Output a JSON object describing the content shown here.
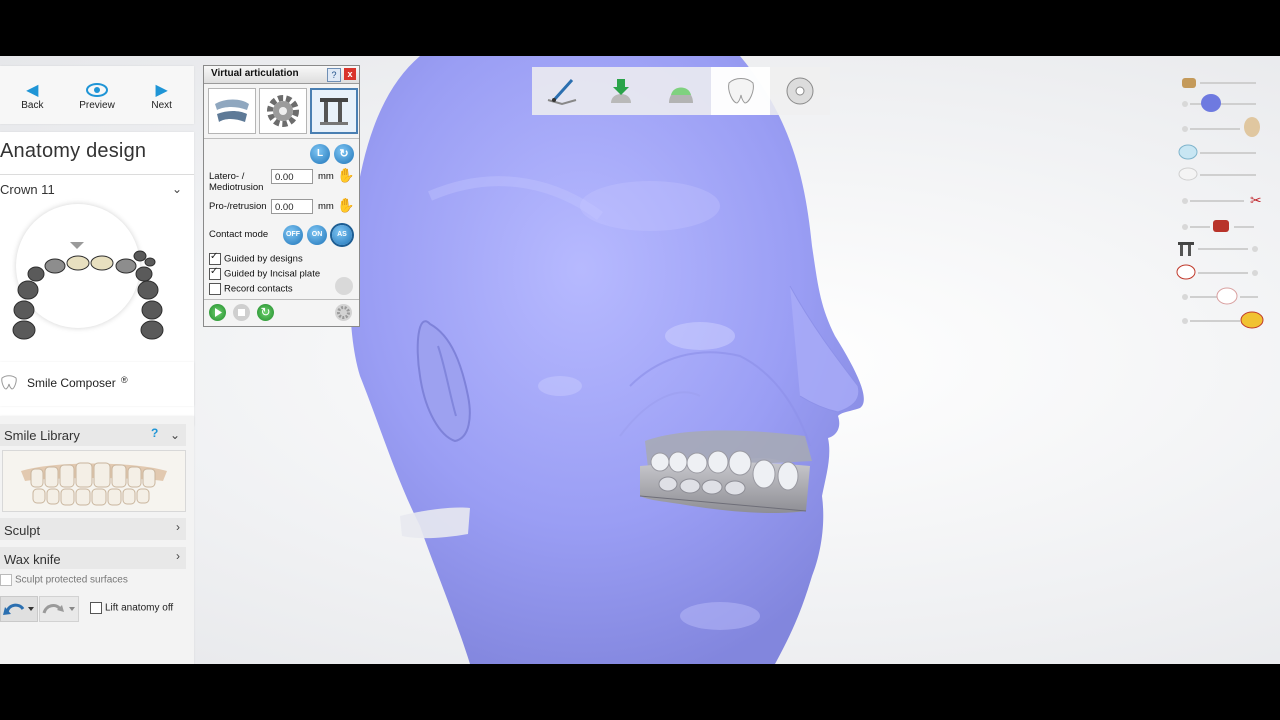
{
  "nav": {
    "back": "Back",
    "preview": "Preview",
    "next": "Next"
  },
  "design": {
    "title": "Anatomy design",
    "tooth": "Crown 11"
  },
  "smile": {
    "label": "Smile Composer",
    "mark": "®"
  },
  "library": {
    "label": "Smile Library",
    "help": "?"
  },
  "sculpt": {
    "label": "Sculpt",
    "wax": "Wax knife",
    "protected": "Sculpt protected surfaces",
    "lift": "Lift anatomy off"
  },
  "va": {
    "title": "Virtual articulation",
    "help": "?",
    "close": "x",
    "btn_l": "L",
    "latero_label_1": "Latero- /",
    "latero_label_2": "Mediotrusion",
    "latero_value": "0.00",
    "pro_label": "Pro-/retrusion",
    "pro_value": "0.00",
    "unit": "mm",
    "contact_label": "Contact mode",
    "off": "OFF",
    "on": "ON",
    "as": "AS",
    "guided_designs": "Guided by designs",
    "guided_incisal": "Guided by Incisal plate",
    "record": "Record contacts",
    "guided_designs_checked": true,
    "guided_incisal_checked": true,
    "record_checked": false
  },
  "steps": [
    "margin-step-icon",
    "insertion-axis-step-icon",
    "cement-gap-step-icon",
    "anatomy-step-icon",
    "output-step-icon"
  ],
  "colors": {
    "accent": "#1f95d6",
    "model": "#8f93f3"
  }
}
